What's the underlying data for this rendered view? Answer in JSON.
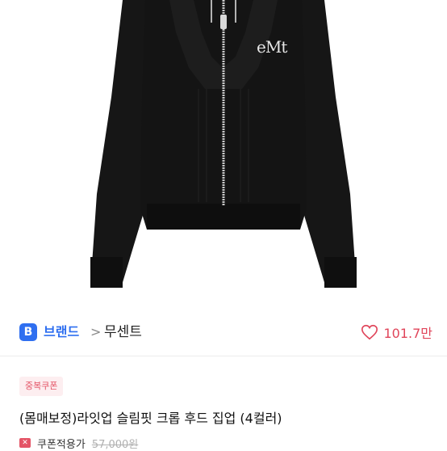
{
  "brand": {
    "badge": "B",
    "label": "브랜드",
    "separator": ">",
    "name": "무센트"
  },
  "like": {
    "count": "101.7만",
    "icon": "heart-outline-icon"
  },
  "coupon_chip": "중복쿠폰",
  "product": {
    "title": "(몸매보정)라잇업 슬림핏 크롭 후드 집업 (4컬러)",
    "image_logo": "eMt"
  },
  "price": {
    "coupon_icon": "coupon-icon",
    "coupon_label": "쿠폰적용가",
    "original_price": "57,000원"
  },
  "colors": {
    "brand_blue": "#2f6ff0",
    "accent_red": "#e0455a",
    "garment": "#141414"
  }
}
